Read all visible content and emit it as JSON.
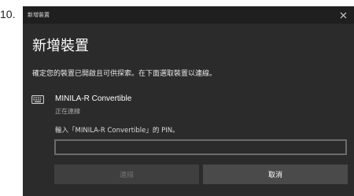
{
  "step_number": "10.",
  "window": {
    "title": "新增裝置",
    "close_icon": "close-icon"
  },
  "heading": "新增裝置",
  "instruction": "確定您的裝置已開啟且可供探索。在下面選取裝置以連線。",
  "device": {
    "icon": "keyboard-icon",
    "name": "MINILA-R Convertible",
    "status": "正在連線"
  },
  "pin": {
    "prompt": "輸入「MINILA-R Convertible」的 PIN。",
    "value": "",
    "placeholder": ""
  },
  "buttons": {
    "connect": "連線",
    "cancel": "取消"
  },
  "colors": {
    "dialog_bg": "#2b2b2b",
    "titlebar_bg": "#1f1f1f",
    "input_border": "#6b6b6b",
    "disabled_button_bg": "#3f3f3f",
    "cancel_button_bg": "#4a4a4a"
  }
}
